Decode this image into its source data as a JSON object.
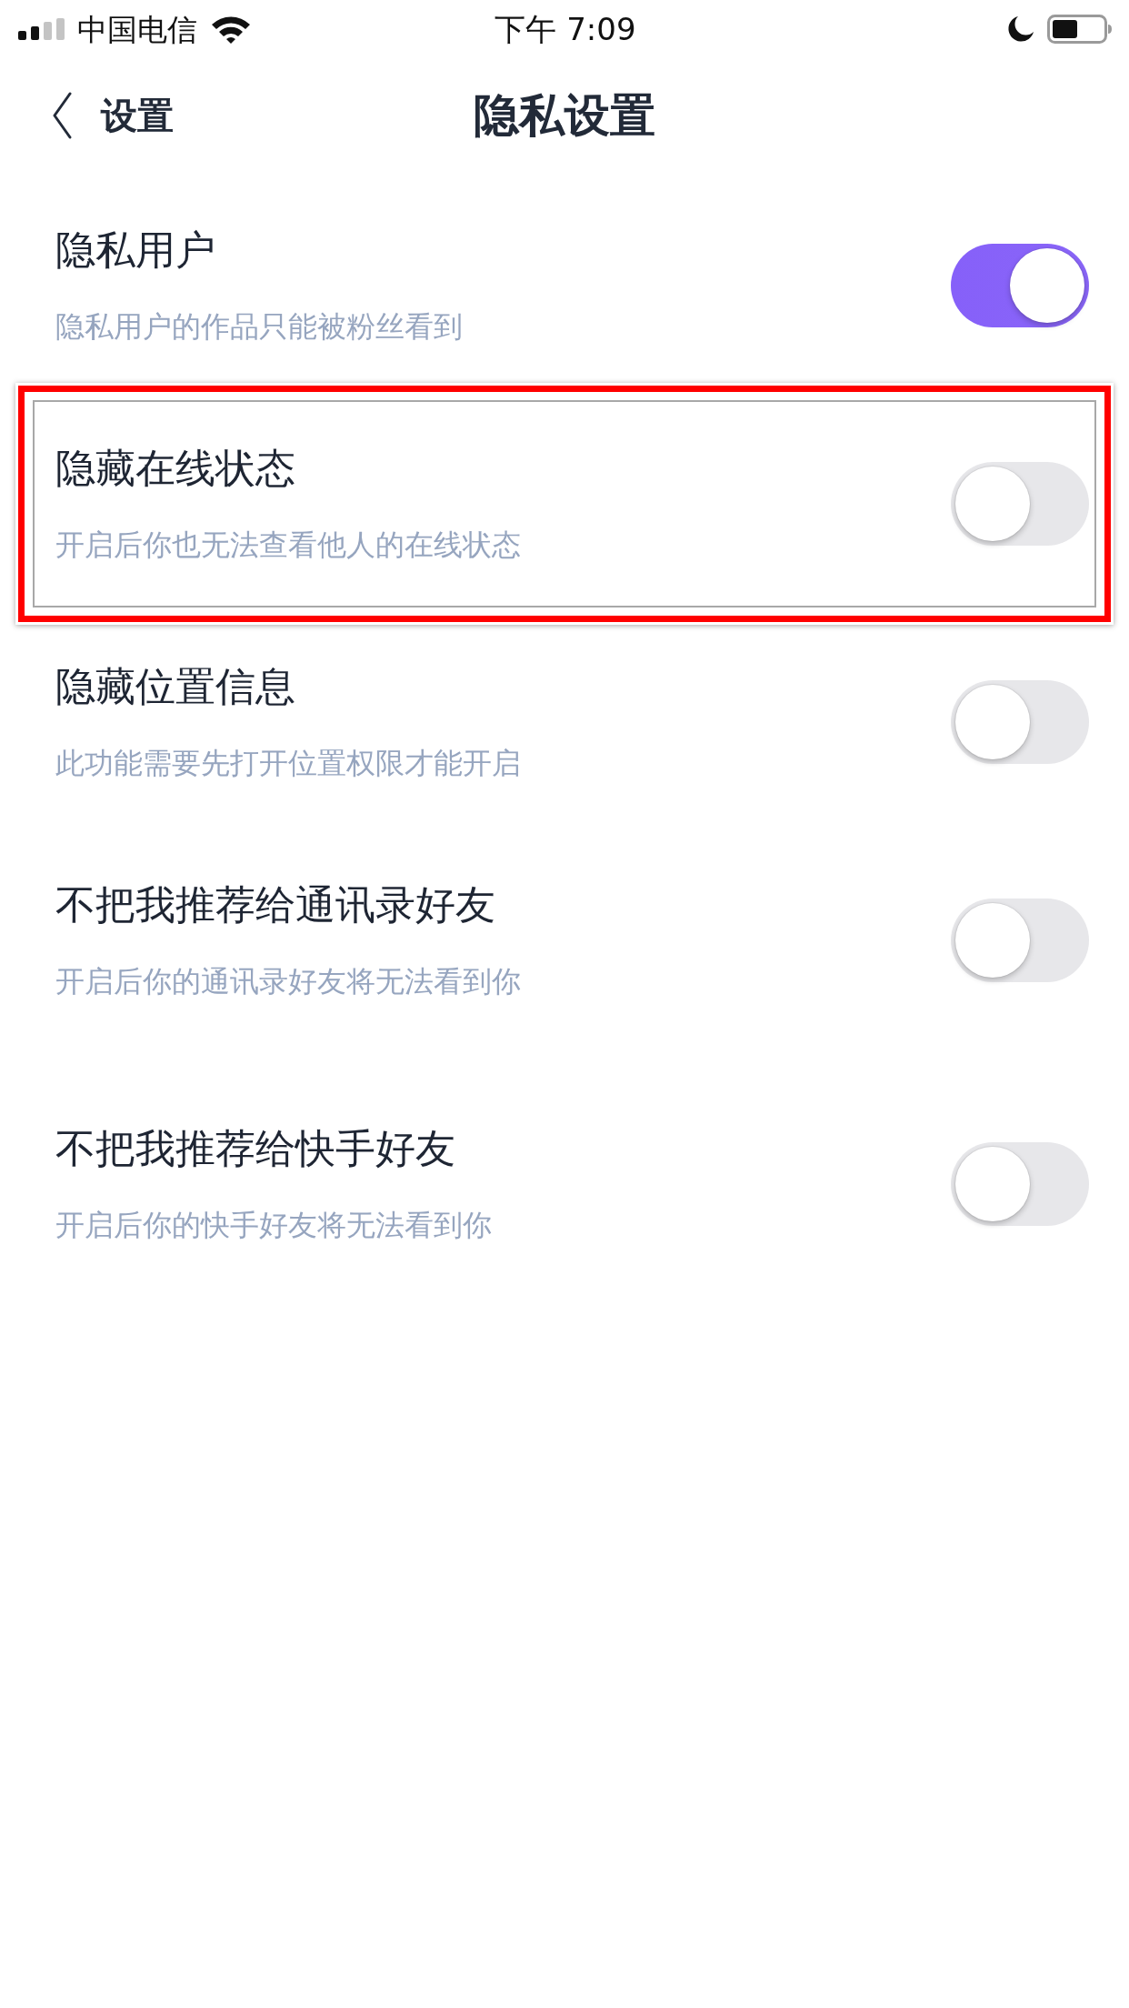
{
  "status_bar": {
    "carrier": "中国电信",
    "time": "下午 7:09"
  },
  "nav": {
    "back_label": "设置",
    "title": "隐私设置"
  },
  "sections": [
    {
      "rows": [
        {
          "title": "隐私用户",
          "subtitle": "隐私用户的作品只能被粉丝看到",
          "on": true,
          "highlighted": false
        },
        {
          "title": "隐藏在线状态",
          "subtitle": "开启后你也无法查看他人的在线状态",
          "on": false,
          "highlighted": true
        },
        {
          "title": "隐藏位置信息",
          "subtitle": "此功能需要先打开位置权限才能开启",
          "on": false,
          "highlighted": false
        },
        {
          "title": "不把我推荐给通讯录好友",
          "subtitle": "开启后你的通讯录好友将无法看到你",
          "on": false,
          "highlighted": false
        }
      ]
    },
    {
      "rows": [
        {
          "title": "不把我推荐给快手好友",
          "subtitle": "开启后你的快手好友将无法看到你",
          "on": false,
          "highlighted": false
        }
      ]
    }
  ]
}
